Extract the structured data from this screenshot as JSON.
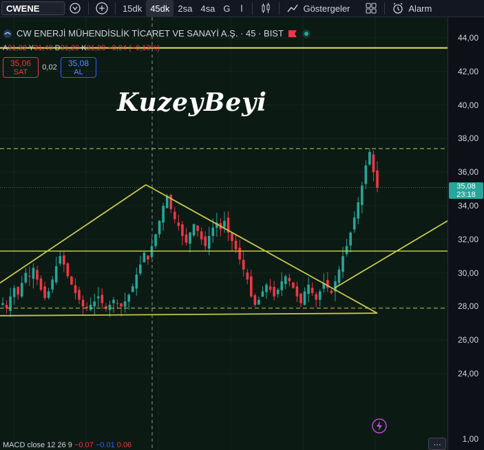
{
  "toolbar": {
    "symbol": "CWENE",
    "timeframes": [
      "15dk",
      "45dk",
      "2sa",
      "4sa",
      "G"
    ],
    "active_timeframe": "45dk",
    "indicators_label": "Göstergeler",
    "alarm_label": "Alarm"
  },
  "legend": {
    "title": "CW ENERJİ MÜHENDİSLİK TİCARET VE SANAYİ A.Ş. · 45 · BIST",
    "open_label": "A",
    "open": "31,32",
    "high_label": "Y",
    "high": "31,40",
    "low_label": "D",
    "low": "31,20",
    "close_label": "K",
    "close": "31,28",
    "change": "−0,04 (−0,13%)"
  },
  "trade": {
    "sell_price": "35,06",
    "sell_label": "SAT",
    "spread": "0,02",
    "buy_price": "35,08",
    "buy_label": "AL"
  },
  "watermark": "KuzeyBeyi",
  "price_axis": {
    "ticks": [
      "44,00",
      "42,00",
      "40,00",
      "38,00",
      "36,00",
      "34,00",
      "32,00",
      "30,00",
      "28,00",
      "26,00",
      "24,00"
    ],
    "last_price": "35,08",
    "countdown": "23:18",
    "macd_tick": "1,00"
  },
  "macd": {
    "label": "MACD close 12 26 9",
    "v1": "−0.07",
    "v2": "−0.01",
    "v3": "0.06"
  },
  "colors": {
    "up": "#26a69a",
    "down": "#f23645",
    "trendline": "#c8c84a",
    "background": "#0c1a14"
  },
  "chart_data": {
    "type": "candlestick",
    "ylim": [
      23,
      45
    ],
    "horizontal_levels": [
      43.4,
      37.4,
      35.08,
      31.3,
      27.9
    ],
    "closes": [
      28.2,
      27.9,
      28.6,
      29.1,
      28.7,
      29.4,
      30.0,
      29.8,
      30.3,
      29.6,
      29.0,
      28.5,
      28.9,
      29.6,
      30.4,
      31.0,
      30.5,
      29.8,
      29.3,
      28.8,
      28.4,
      28.0,
      27.9,
      28.1,
      28.3,
      28.6,
      28.2,
      27.9,
      28.1,
      28.4,
      28.2,
      28.0,
      28.3,
      28.7,
      29.2,
      29.9,
      30.5,
      31.2,
      30.8,
      31.6,
      32.3,
      33.1,
      34.0,
      34.6,
      33.8,
      33.2,
      32.8,
      32.2,
      31.8,
      32.4,
      32.9,
      32.5,
      32.0,
      31.6,
      32.2,
      32.7,
      33.0,
      32.6,
      33.1,
      32.4,
      31.9,
      31.4,
      30.8,
      30.2,
      29.6,
      28.6,
      28.1,
      28.4,
      28.9,
      29.3,
      29.0,
      28.6,
      29.0,
      29.5,
      29.8,
      29.5,
      29.1,
      28.6,
      28.2,
      28.9,
      29.3,
      28.8,
      28.4,
      28.9,
      29.4,
      29.1,
      28.8,
      29.5,
      30.2,
      31.0,
      31.6,
      32.4,
      33.3,
      34.2,
      35.2,
      36.4,
      37.2,
      36.0,
      35.08
    ]
  }
}
